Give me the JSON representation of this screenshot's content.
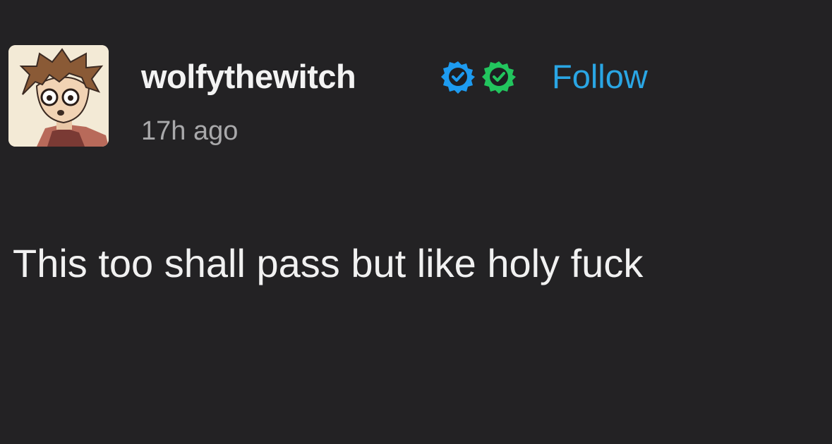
{
  "post": {
    "author": {
      "username": "wolfythewitch",
      "badges": [
        {
          "icon": "verified-badge-icon",
          "color": "#1d9bf0"
        },
        {
          "icon": "verified-badge-icon",
          "color": "#22c55e"
        }
      ]
    },
    "follow_label": "Follow",
    "timestamp": "17h ago",
    "text": "This too shall pass but like holy fuck"
  },
  "colors": {
    "background": "#232224",
    "text_primary": "#f2f2f2",
    "text_secondary": "#a9a9ab",
    "follow_link": "#2aa6e4",
    "badge_blue": "#1d9bf0",
    "badge_green": "#22c55e"
  }
}
